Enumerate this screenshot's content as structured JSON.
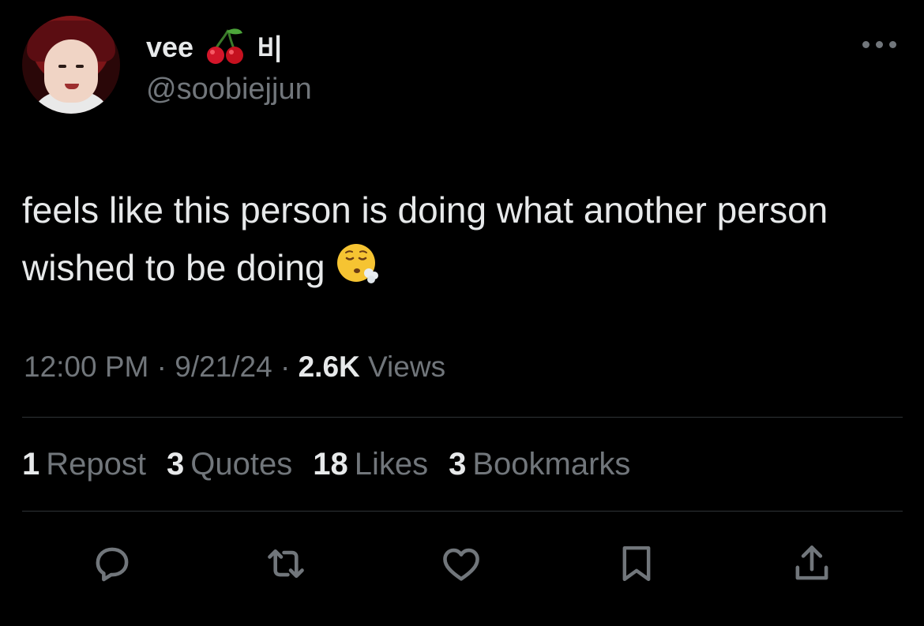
{
  "author": {
    "display_name": "vee",
    "name_suffix": "비",
    "handle": "@soobiejjun",
    "name_emoji_icon": "cherries-icon"
  },
  "tweet": {
    "text": "feels like this person is doing what another person wished to be doing",
    "emoji_icon": "face-exhaling-icon"
  },
  "meta": {
    "time": "12:00 PM",
    "separator": "·",
    "date": "9/21/24",
    "views_count": "2.6K",
    "views_label": "Views"
  },
  "stats": [
    {
      "count": "1",
      "label": "Repost"
    },
    {
      "count": "3",
      "label": "Quotes"
    },
    {
      "count": "18",
      "label": "Likes"
    },
    {
      "count": "3",
      "label": "Bookmarks"
    }
  ],
  "actions": [
    {
      "name": "reply",
      "icon": "reply-bubble-icon"
    },
    {
      "name": "repost",
      "icon": "repost-arrows-icon"
    },
    {
      "name": "like",
      "icon": "heart-icon"
    },
    {
      "name": "bookmark",
      "icon": "bookmark-icon"
    },
    {
      "name": "share",
      "icon": "share-upload-icon"
    }
  ],
  "colors": {
    "background": "#000000",
    "primary_text": "#e7e9ea",
    "secondary_text": "#71767b",
    "divider": "#2f3336",
    "cherry_red": "#d3162a"
  }
}
